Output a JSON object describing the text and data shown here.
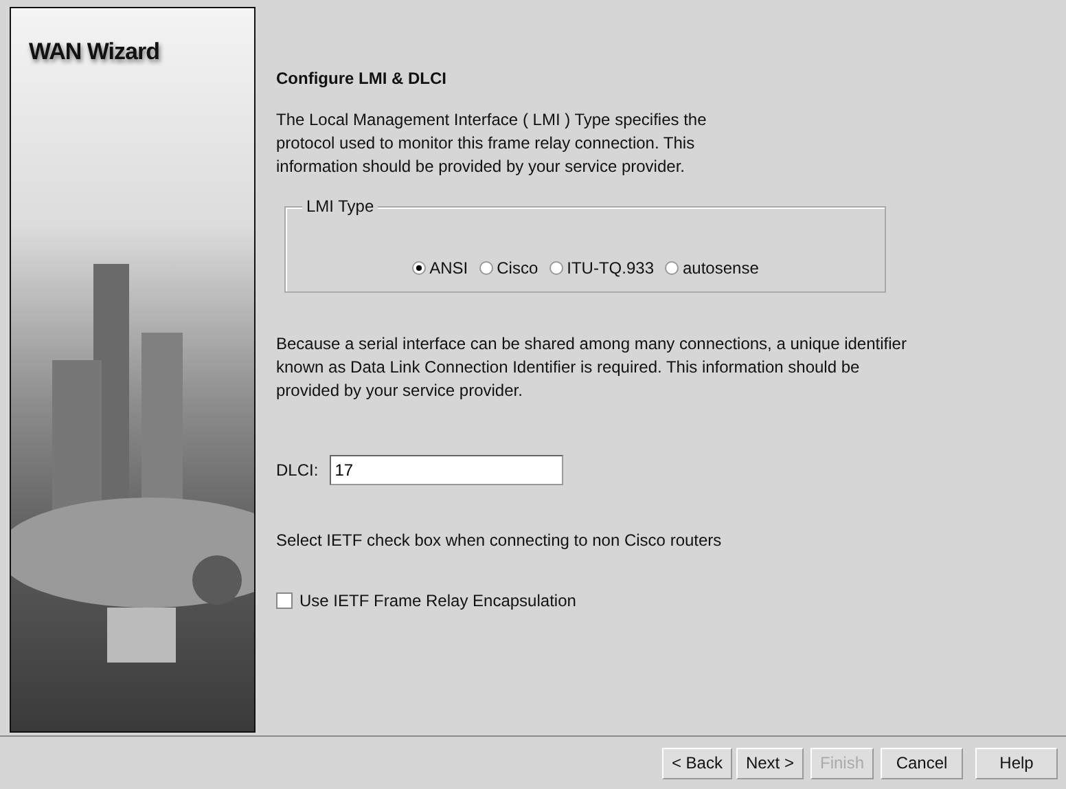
{
  "sidebar": {
    "title": "WAN Wizard"
  },
  "heading": "Configure LMI & DLCI",
  "intro": "The Local Management Interface ( LMI ) Type specifies the protocol used to monitor this frame relay connection. This information should be provided by your service provider.",
  "lmi_type": {
    "legend": "LMI Type",
    "options": [
      {
        "label": "ANSI",
        "selected": true
      },
      {
        "label": "Cisco",
        "selected": false
      },
      {
        "label": "ITU-TQ.933",
        "selected": false
      },
      {
        "label": "autosense",
        "selected": false
      }
    ]
  },
  "dlci_note": "Because a serial interface can be shared among many connections, a unique identifier known as Data Link Connection Identifier is required. This information should be provided by your service provider.",
  "dlci": {
    "label": "DLCI:",
    "value": "17"
  },
  "ietf_note": "Select IETF check box when connecting to non Cisco routers",
  "ietf_checkbox": {
    "label": "Use IETF Frame Relay Encapsulation",
    "checked": false
  },
  "buttons": [
    {
      "label": "< Back",
      "disabled": false
    },
    {
      "label": "Next >",
      "disabled": false
    },
    {
      "label": "Finish",
      "disabled": true
    },
    {
      "label": "Cancel",
      "disabled": false
    },
    {
      "label": "Help",
      "disabled": false
    }
  ]
}
